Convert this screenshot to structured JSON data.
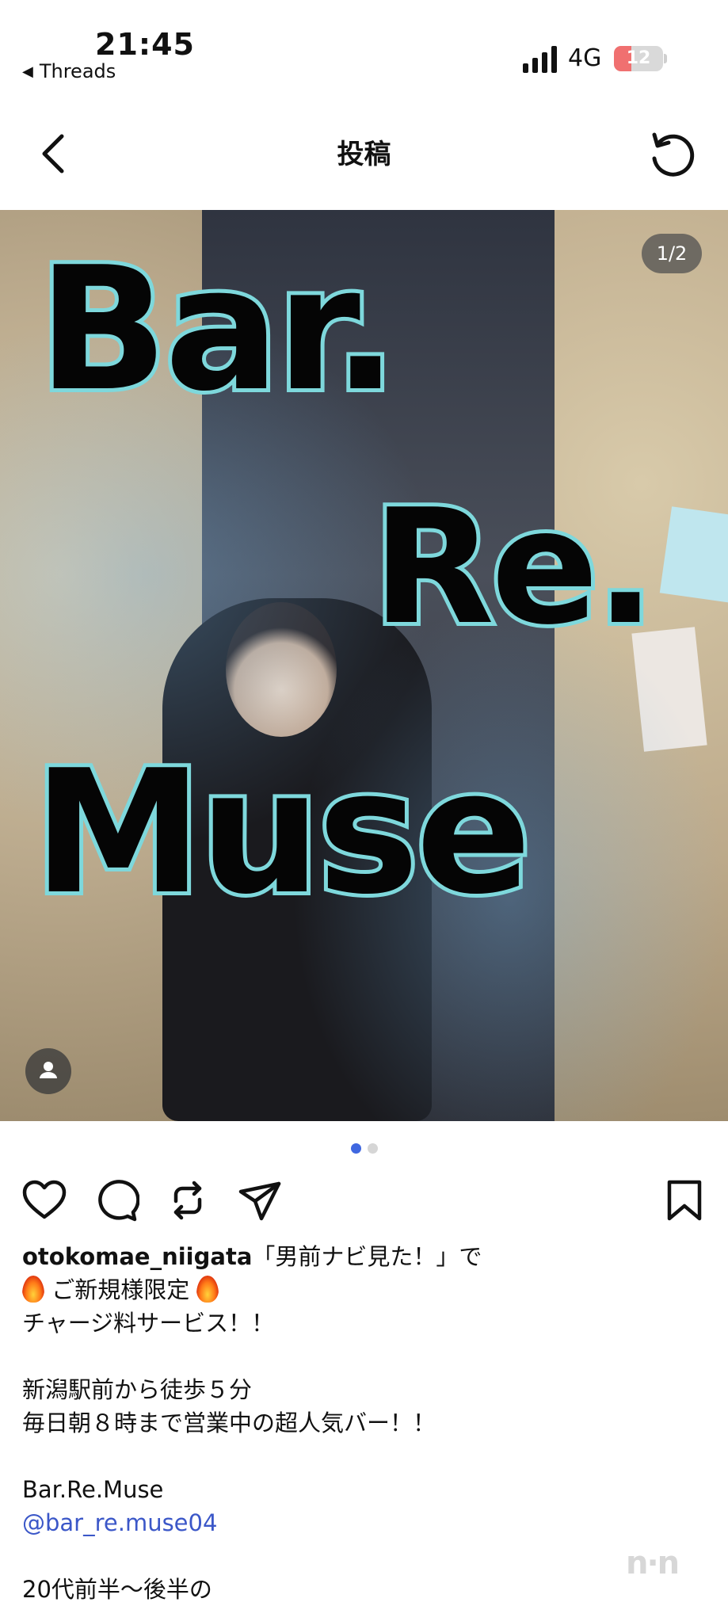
{
  "status_bar": {
    "time": "21:45",
    "back_app": "Threads",
    "network": "4G",
    "battery": "12",
    "battery_level": 0.12
  },
  "header": {
    "title": "投稿",
    "back_icon": "chevron-left-icon",
    "refresh_icon": "refresh-icon"
  },
  "post": {
    "page_indicator": "1/2",
    "image_text": [
      "Bar.",
      "Re.",
      "Muse"
    ],
    "dots": {
      "total": 2,
      "active": 1
    },
    "actions": {
      "like_icon": "heart-icon",
      "comment_icon": "comment-icon",
      "repost_icon": "repost-icon",
      "share_icon": "send-icon",
      "save_icon": "bookmark-icon"
    },
    "caption": {
      "username": "otokomae_niigata",
      "line1": "「男前ナビ見た！」で",
      "line2": "ご新規様限定",
      "line3": "チャージ料サービス！！",
      "line4": "新潟駅前から徒歩５分",
      "line5": "毎日朝８時まで営業中の超人気バー！！",
      "line6": "Bar.Re.Muse",
      "mention": "@bar_re.muse04",
      "line7": "20代前半〜後半の"
    }
  },
  "colors": {
    "accent_blue": "#3f67e0",
    "mention_blue": "#3b57c8",
    "overlay_outline": "#7ed8dc"
  }
}
